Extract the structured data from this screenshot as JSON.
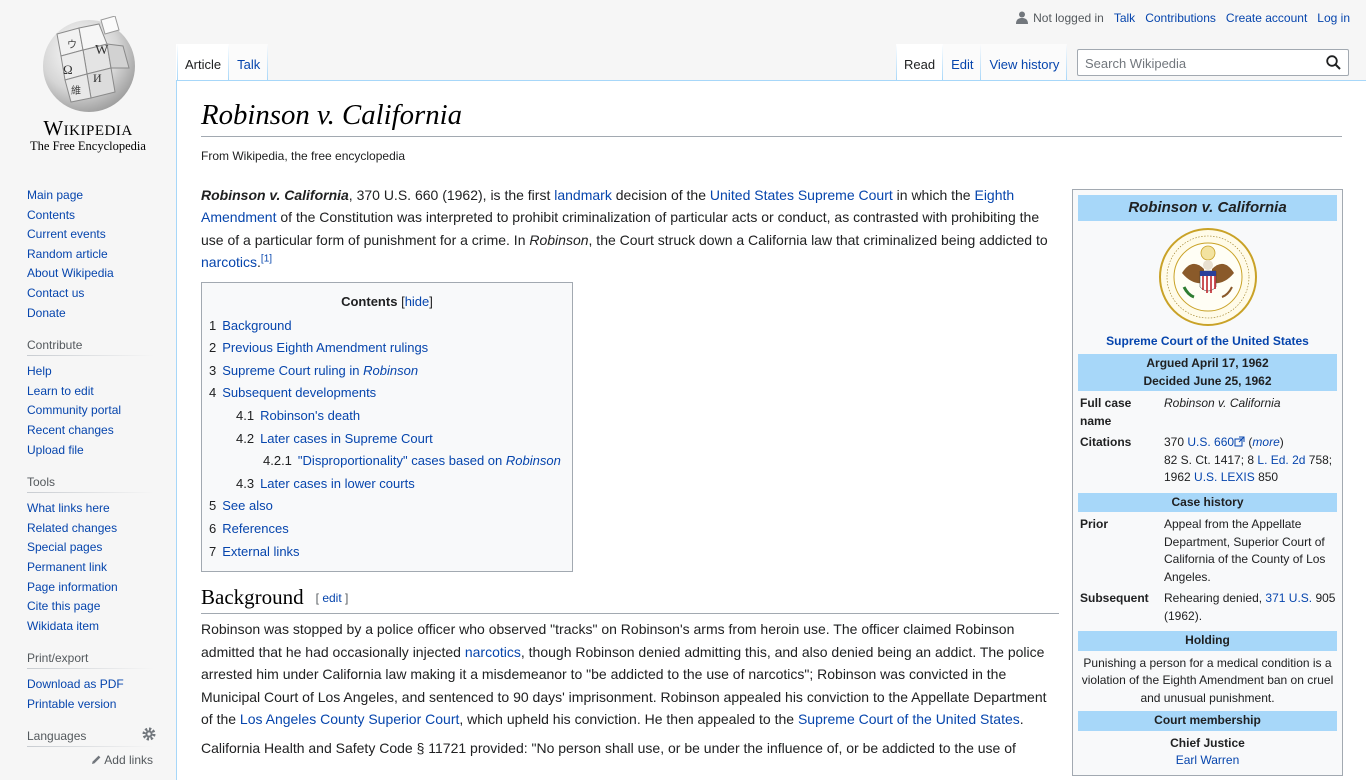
{
  "logo": {
    "wordmark": "Wikipedia",
    "tagline": "The Free Encyclopedia"
  },
  "personal_tools": {
    "not_logged_in": "Not logged in",
    "talk": "Talk",
    "contributions": "Contributions",
    "create_account": "Create account",
    "log_in": "Log in"
  },
  "tabs_left": [
    {
      "label": "Article",
      "selected": true
    },
    {
      "label": "Talk",
      "selected": false
    }
  ],
  "tabs_right": [
    {
      "label": "Read",
      "selected": true
    },
    {
      "label": "Edit",
      "selected": false
    },
    {
      "label": "View history",
      "selected": false
    }
  ],
  "search": {
    "placeholder": "Search Wikipedia"
  },
  "sidebar": {
    "navigation": [
      "Main page",
      "Contents",
      "Current events",
      "Random article",
      "About Wikipedia",
      "Contact us",
      "Donate"
    ],
    "contribute_heading": "Contribute",
    "contribute": [
      "Help",
      "Learn to edit",
      "Community portal",
      "Recent changes",
      "Upload file"
    ],
    "tools_heading": "Tools",
    "tools": [
      "What links here",
      "Related changes",
      "Special pages",
      "Permanent link",
      "Page information",
      "Cite this page",
      "Wikidata item"
    ],
    "print_heading": "Print/export",
    "print": [
      "Download as PDF",
      "Printable version"
    ],
    "languages_heading": "Languages",
    "add_links": "Add links"
  },
  "article": {
    "title": "Robinson v. California",
    "from": "From Wikipedia, the free encyclopedia",
    "lead": {
      "subject": "Robinson v. California",
      "t1": ", 370 U.S. 660 (1962), is the first ",
      "l1": "landmark",
      "t2": " decision of the ",
      "l2": "United States Supreme Court",
      "t3": " in which the ",
      "l3": "Eighth Amendment",
      "t4": " of the Constitution was interpreted to prohibit criminalization of particular acts or conduct, as contrasted with prohibiting the use of a particular form of punishment for a crime. In ",
      "t4i": "Robinson",
      "t5": ", the Court struck down a California law that criminalized being addicted to ",
      "l4": "narcotics",
      "t6": ".",
      "ref": "[1]"
    },
    "toc": {
      "title": "Contents",
      "hide": "hide",
      "items": [
        {
          "num": "1",
          "label": "Background",
          "level": 1
        },
        {
          "num": "2",
          "label": "Previous Eighth Amendment rulings",
          "level": 1
        },
        {
          "num": "3",
          "label": "Supreme Court ruling in ",
          "italic": "Robinson",
          "level": 1
        },
        {
          "num": "4",
          "label": "Subsequent developments",
          "level": 1
        },
        {
          "num": "4.1",
          "label": "Robinson's death",
          "level": 2
        },
        {
          "num": "4.2",
          "label": "Later cases in Supreme Court",
          "level": 2
        },
        {
          "num": "4.2.1",
          "label": "\"Disproportionality\" cases based on ",
          "italic": "Robinson",
          "level": 3
        },
        {
          "num": "4.3",
          "label": "Later cases in lower courts",
          "level": 2
        },
        {
          "num": "5",
          "label": "See also",
          "level": 1
        },
        {
          "num": "6",
          "label": "References",
          "level": 1
        },
        {
          "num": "7",
          "label": "External links",
          "level": 1
        }
      ]
    },
    "background": {
      "heading": "Background",
      "edit": "edit",
      "p1a": "Robinson was stopped by a police officer who observed \"tracks\" on Robinson's arms from heroin use. The officer claimed Robinson admitted that he had occasionally injected ",
      "p1l1": "narcotics",
      "p1b": ", though Robinson denied admitting this, and also denied being an addict. The police arrested him under California law making it a misdemeanor to \"be addicted to the use of narcotics\"; Robinson was convicted in the Municipal Court of Los Angeles, and sentenced to 90 days' imprisonment. Robinson appealed his conviction to the Appellate Department of the ",
      "p1l2": "Los Angeles County Superior Court",
      "p1c": ", which upheld his conviction. He then appealed to the ",
      "p1l3": "Supreme Court of the United States",
      "p1d": ".",
      "p2": "California Health and Safety Code § 11721 provided: \"No person shall use, or be under the influence of, or be addicted to the use of"
    }
  },
  "infobox": {
    "title": "Robinson v. California",
    "court": "Supreme Court of the United States",
    "argued": "Argued April 17, 1962",
    "decided": "Decided June 25, 1962",
    "full_case_label": "Full case name",
    "full_case_value": "Robinson v. California",
    "citations_label": "Citations",
    "cit_a": "370 ",
    "cit_l1": "U.S. 660",
    "cit_b": " (",
    "cit_more": "more",
    "cit_c": ")",
    "cit_d": "82 S. Ct. 1417; 8 ",
    "cit_l2": "L. Ed. 2d",
    "cit_e": " 758; 1962 ",
    "cit_l3": "U.S. LEXIS",
    "cit_f": " 850",
    "history_band": "Case history",
    "prior_label": "Prior",
    "prior_value": "Appeal from the Appellate Department, Superior Court of California of the County of Los Angeles.",
    "subsequent_label": "Subsequent",
    "subsequent_a": "Rehearing denied, ",
    "subsequent_link": "371 U.S.",
    "subsequent_b": " 905 (1962).",
    "holding_band": "Holding",
    "holding": "Punishing a person for a medical condition is a violation of the Eighth Amendment ban on cruel and unusual punishment.",
    "membership_band": "Court membership",
    "chief_label": "Chief Justice",
    "chief_name": "Earl Warren"
  }
}
